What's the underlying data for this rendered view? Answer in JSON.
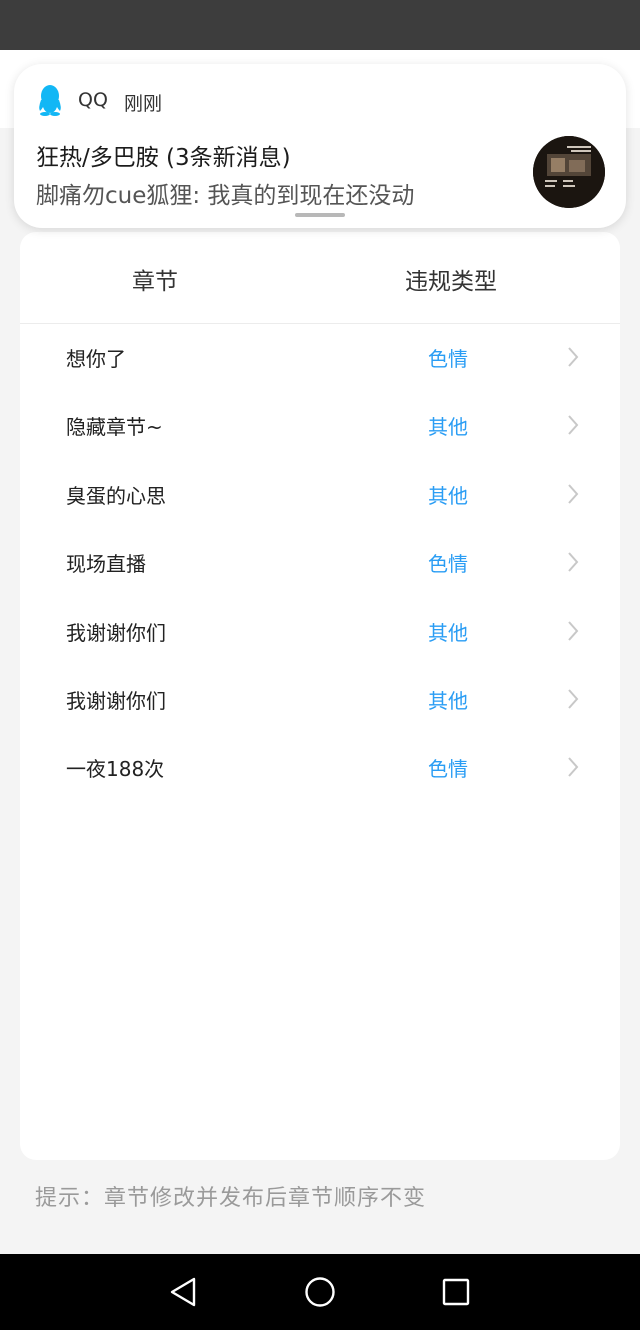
{
  "notification": {
    "app_name": "QQ",
    "time": "刚刚",
    "title": "狂热/多巴胺 (3条新消息)",
    "body": "脚痛勿cue狐狸: 我真的到现在还没动",
    "app_icon": "qq-penguin-icon"
  },
  "table": {
    "headers": {
      "chapter": "章节",
      "violation_type": "违规类型"
    },
    "rows": [
      {
        "chapter": "想你了",
        "type": "色情"
      },
      {
        "chapter": "隐藏章节~",
        "type": "其他"
      },
      {
        "chapter": "臭蛋的心思",
        "type": "其他"
      },
      {
        "chapter": "现场直播",
        "type": "色情"
      },
      {
        "chapter": "我谢谢你们",
        "type": "其他"
      },
      {
        "chapter": "我谢谢你们",
        "type": "其他"
      },
      {
        "chapter": "一夜188次",
        "type": "色情"
      }
    ]
  },
  "hint": "提示：章节修改并发布后章节顺序不变",
  "colors": {
    "accent": "#2a9df4",
    "qq_icon": "#12b7f5",
    "status_bar": "#3d3d3d",
    "nav_bar": "#000000"
  },
  "nav": [
    "back-icon",
    "home-icon",
    "recent-apps-icon"
  ]
}
